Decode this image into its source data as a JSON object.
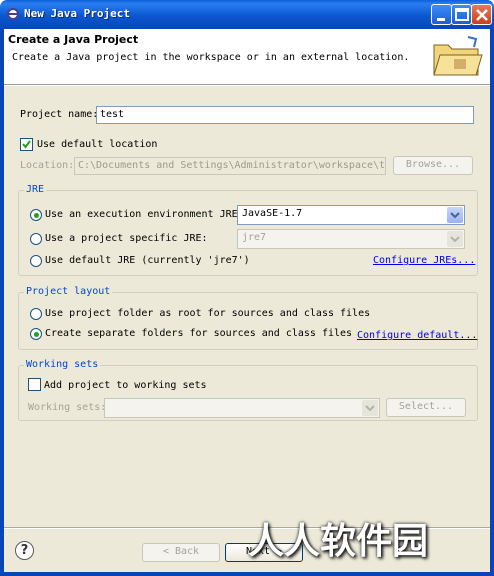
{
  "window": {
    "title": "New Java Project"
  },
  "banner": {
    "title": "Create a Java Project",
    "description": "Create a Java project in the workspace or in an external location."
  },
  "project": {
    "name_label": "Project name:",
    "name_value": "test",
    "use_default_label": "Use default location",
    "use_default_checked": true,
    "location_label": "Location:",
    "location_value": "C:\\Documents and Settings\\Administrator\\workspace\\test",
    "browse_label": "Browse..."
  },
  "jre": {
    "group_title": "JRE",
    "option_env_label": "Use an execution environment JRE:",
    "option_env_value": "JavaSE-1.7",
    "option_specific_label": "Use a project specific JRE:",
    "option_specific_value": "jre7",
    "option_default_label": "Use default JRE (currently 'jre7')",
    "configure_link": "Configure JREs...",
    "selected": "env"
  },
  "layout": {
    "group_title": "Project layout",
    "option_root_label": "Use project folder as root for sources and class files",
    "option_separate_label": "Create separate folders for sources and class files",
    "configure_link": "Configure default...",
    "selected": "separate"
  },
  "working_sets": {
    "group_title": "Working sets",
    "add_label": "Add project to working sets",
    "add_checked": false,
    "sets_label": "Working sets:",
    "select_label": "Select..."
  },
  "footer": {
    "back_label": "< Back",
    "next_label": "Next >"
  },
  "watermark": "人人软件园",
  "colors": {
    "titlebar": "#0a57d0",
    "dialog_bg": "#ece9d8",
    "group_title": "#0046d5",
    "link": "#0000ee"
  }
}
